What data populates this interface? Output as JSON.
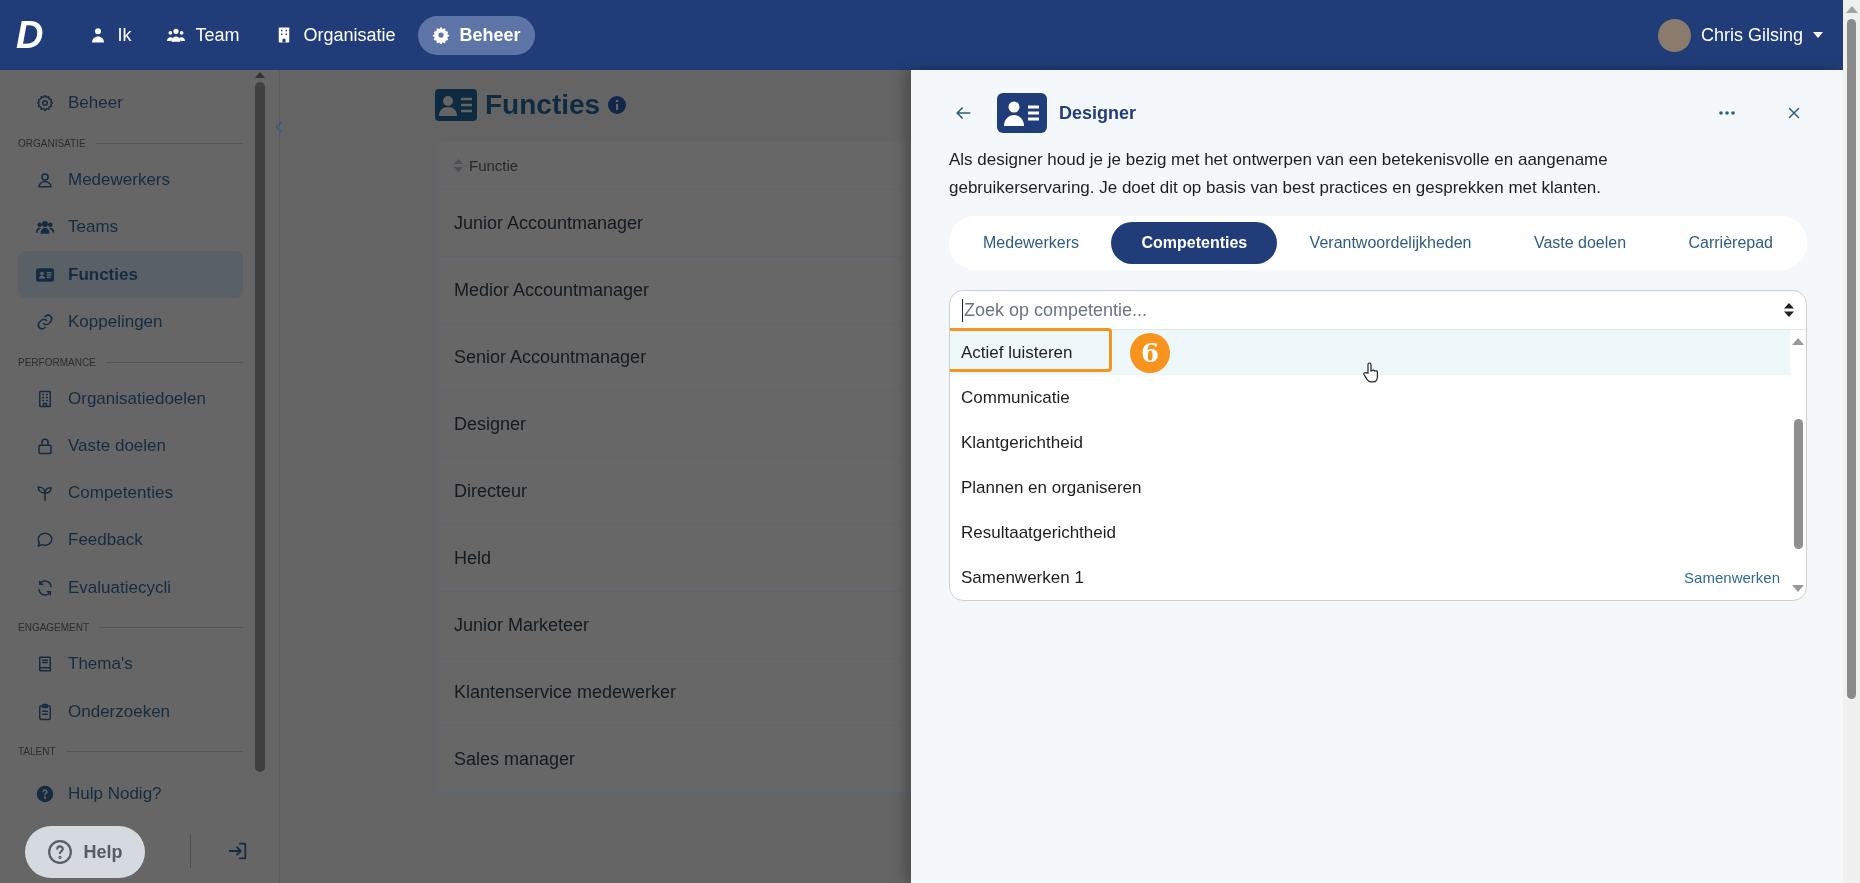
{
  "top_nav": {
    "logo": "D",
    "items": [
      {
        "label": "Ik",
        "selected": false
      },
      {
        "label": "Team",
        "selected": false
      },
      {
        "label": "Organisatie",
        "selected": false
      },
      {
        "label": "Beheer",
        "selected": true
      }
    ],
    "user": {
      "name": "Chris Gilsing"
    }
  },
  "sidebar": {
    "top_item": {
      "label": "Beheer",
      "selected": false
    },
    "sections": [
      {
        "title": "ORGANISATIE",
        "items": [
          {
            "label": "Medewerkers",
            "selected": false
          },
          {
            "label": "Teams",
            "selected": false
          },
          {
            "label": "Functies",
            "selected": true
          },
          {
            "label": "Koppelingen",
            "selected": false
          }
        ]
      },
      {
        "title": "PERFORMANCE",
        "items": [
          {
            "label": "Organisatiedoelen",
            "selected": false
          },
          {
            "label": "Vaste doelen",
            "selected": false
          },
          {
            "label": "Competenties",
            "selected": false
          },
          {
            "label": "Feedback",
            "selected": false
          },
          {
            "label": "Evaluatiecycli",
            "selected": false
          }
        ]
      },
      {
        "title": "ENGAGEMENT",
        "items": [
          {
            "label": "Thema's",
            "selected": false
          },
          {
            "label": "Onderzoeken",
            "selected": false
          }
        ]
      },
      {
        "title": "TALENT"
      }
    ],
    "help_item": "Hulp Nodig?",
    "help_button": "Help"
  },
  "page": {
    "title": "Functies",
    "table": {
      "columns": [
        "Functie"
      ],
      "rows": [
        "Junior Accountmanager",
        "Medior Accountmanager",
        "Senior Accountmanager",
        "Designer",
        "Directeur",
        "Held",
        "Junior Marketeer",
        "Klantenservice medewerker",
        "Sales manager"
      ]
    }
  },
  "panel": {
    "title": "Designer",
    "description": "Als designer houd je je bezig met het ontwerpen van een betekenisvolle en aangename gebruikerservaring. Je doet dit op basis van best practices en gesprekken met klanten.",
    "tabs": [
      {
        "label": "Medewerkers",
        "selected": false
      },
      {
        "label": "Competenties",
        "selected": true
      },
      {
        "label": "Verantwoordelijkheden",
        "selected": false
      },
      {
        "label": "Vaste doelen",
        "selected": false
      },
      {
        "label": "Carrièrepad",
        "selected": false
      }
    ],
    "search": {
      "placeholder": "Zoek op competentie..."
    },
    "options": [
      {
        "label": "Actief luisteren",
        "highlighted": true
      },
      {
        "label": "Communicatie",
        "highlighted": false
      },
      {
        "label": "Klantgerichtheid",
        "highlighted": false
      },
      {
        "label": "Plannen en organiseren",
        "highlighted": false
      },
      {
        "label": "Resultaatgerichtheid",
        "highlighted": false
      },
      {
        "label": "Samenwerken 1",
        "highlighted": false,
        "tag": "Samenwerken"
      }
    ],
    "annotation": {
      "step": "6"
    }
  }
}
